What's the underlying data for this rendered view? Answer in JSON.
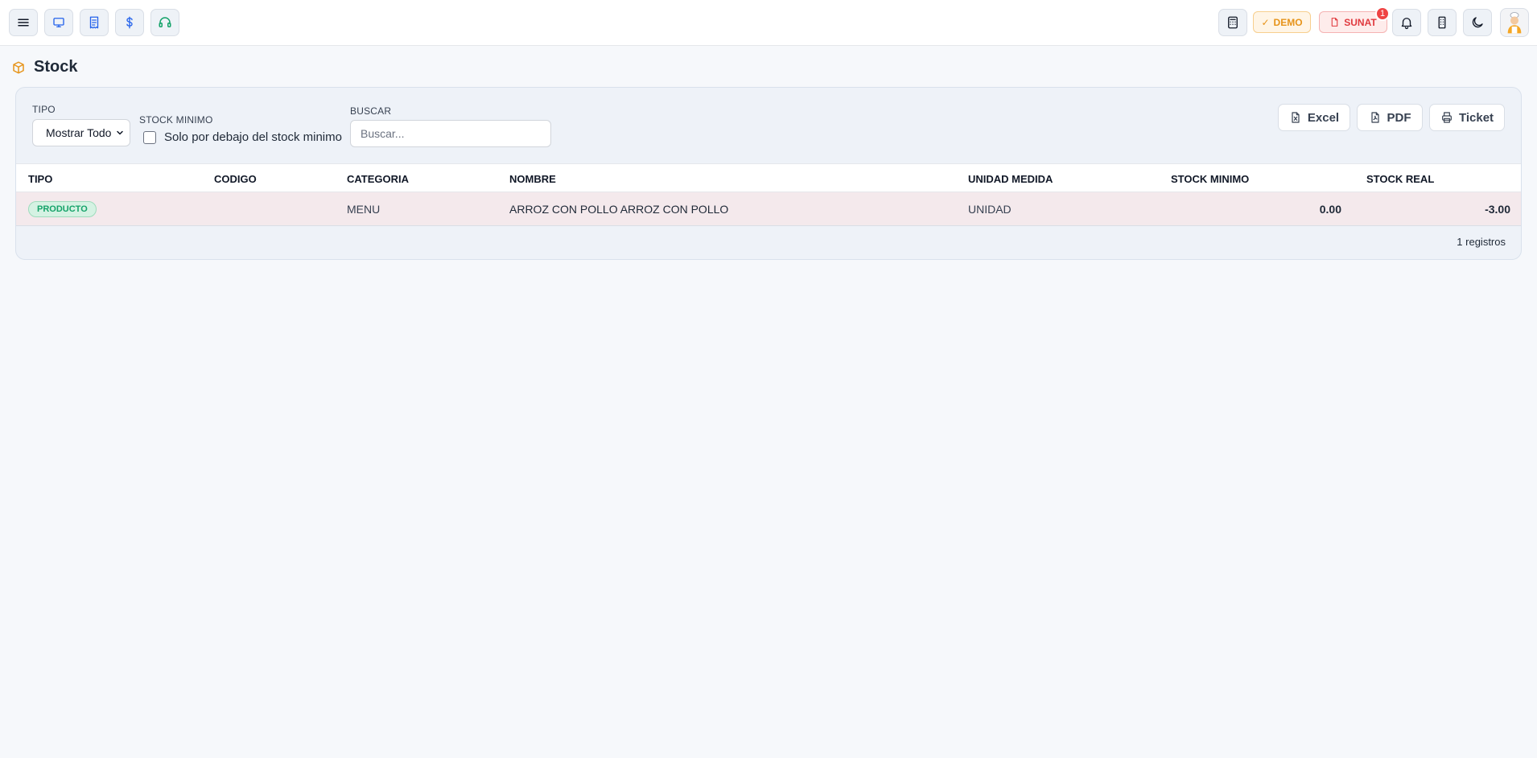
{
  "topbar": {
    "left_buttons": [
      {
        "icon": "menu-icon"
      },
      {
        "icon": "monitor-icon"
      },
      {
        "icon": "receipt-icon"
      },
      {
        "icon": "dollar-icon"
      },
      {
        "icon": "headset-icon"
      }
    ],
    "demo_label": "DEMO",
    "sunat_label": "SUNAT",
    "sunat_badge_count": "1",
    "right_icons": [
      "calculator-icon",
      "bell-icon",
      "building-icon",
      "moon-icon"
    ],
    "colors": {
      "demo": "#e6941a",
      "sunat": "#e0393e",
      "accent": "#2563eb"
    }
  },
  "page": {
    "title": "Stock",
    "icon": "box-icon"
  },
  "filters": {
    "tipo_label": "TIPO",
    "tipo_value": "Mostrar Todo",
    "stock_minimo_label": "STOCK MINIMO",
    "stock_minimo_checkbox_label": "Solo por debajo del stock minimo",
    "stock_minimo_checked": false,
    "buscar_label": "BUSCAR",
    "buscar_placeholder": "Buscar...",
    "buscar_value": ""
  },
  "actions": {
    "excel": "Excel",
    "pdf": "PDF",
    "ticket": "Ticket"
  },
  "table": {
    "headers": [
      "TIPO",
      "CODIGO",
      "CATEGORIA",
      "NOMBRE",
      "UNIDAD MEDIDA",
      "STOCK MINIMO",
      "STOCK REAL"
    ],
    "rows": [
      {
        "tipo": "PRODUCTO",
        "codigo": "",
        "categoria": "MENU",
        "nombre": "ARROZ CON POLLO ARROZ CON POLLO",
        "unidad_medida": "UNIDAD",
        "stock_minimo": "0.00",
        "stock_real": "-3.00"
      }
    ]
  },
  "footer": {
    "count": "1 registros"
  }
}
